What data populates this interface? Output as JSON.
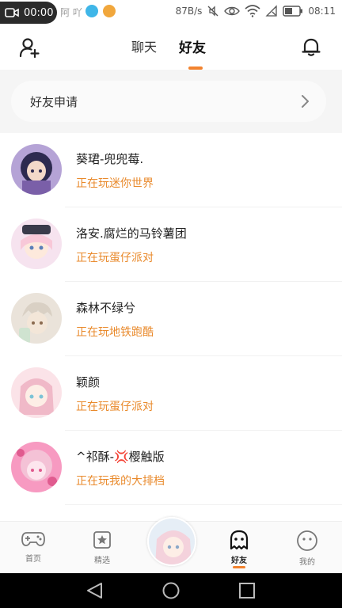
{
  "status_bar": {
    "recording_time": "00:00",
    "carrier_fragment": "阿 吖",
    "network_speed": "87B/s",
    "clock": "08:11",
    "icons": [
      "video-camera-icon",
      "app-icon-blue",
      "app-icon-orange",
      "silent-icon",
      "eye-icon",
      "wifi-icon",
      "no-signal-icon",
      "battery-icon"
    ]
  },
  "header": {
    "tabs": [
      {
        "label": "聊天",
        "active": false
      },
      {
        "label": "好友",
        "active": true
      }
    ],
    "accent": "#f2832f"
  },
  "friend_request": {
    "label": "好友申请"
  },
  "friends": [
    {
      "name": "葵珺-兜兜莓.",
      "status": "正在玩迷你世界",
      "avatar_colors": [
        "#2d2a4f",
        "#7a5fa8",
        "#f3d9c9"
      ]
    },
    {
      "name": "洛安.腐烂的马铃薯团",
      "status": "正在玩蛋仔派对",
      "avatar_colors": [
        "#f6e3ef",
        "#f8c8d8",
        "#5a7fb8"
      ]
    },
    {
      "name": "森林不绿兮",
      "status": "正在玩地铁跑酷",
      "avatar_colors": [
        "#d9d0c4",
        "#f3e6d8",
        "#8a6a4f"
      ]
    },
    {
      "name": "颖颜",
      "status": "正在玩蛋仔派对",
      "avatar_colors": [
        "#fbe3e8",
        "#f0b9c8",
        "#a8d8e6"
      ]
    },
    {
      "name": "^祁酥-💢樱触版",
      "status": "正在玩我的大排档",
      "avatar_colors": [
        "#f79ac1",
        "#f4c2d6",
        "#e05b8f"
      ]
    }
  ],
  "status_color": "#e98a2c",
  "bottom_nav": {
    "items": [
      {
        "label": "首页",
        "icon": "gamepad-icon"
      },
      {
        "label": "精选",
        "icon": "star-badge-icon"
      },
      {
        "label": "",
        "icon": "center-avatar"
      },
      {
        "label": "好友",
        "icon": "ghost-icon",
        "active": true
      },
      {
        "label": "我的",
        "icon": "smiley-icon"
      }
    ]
  }
}
